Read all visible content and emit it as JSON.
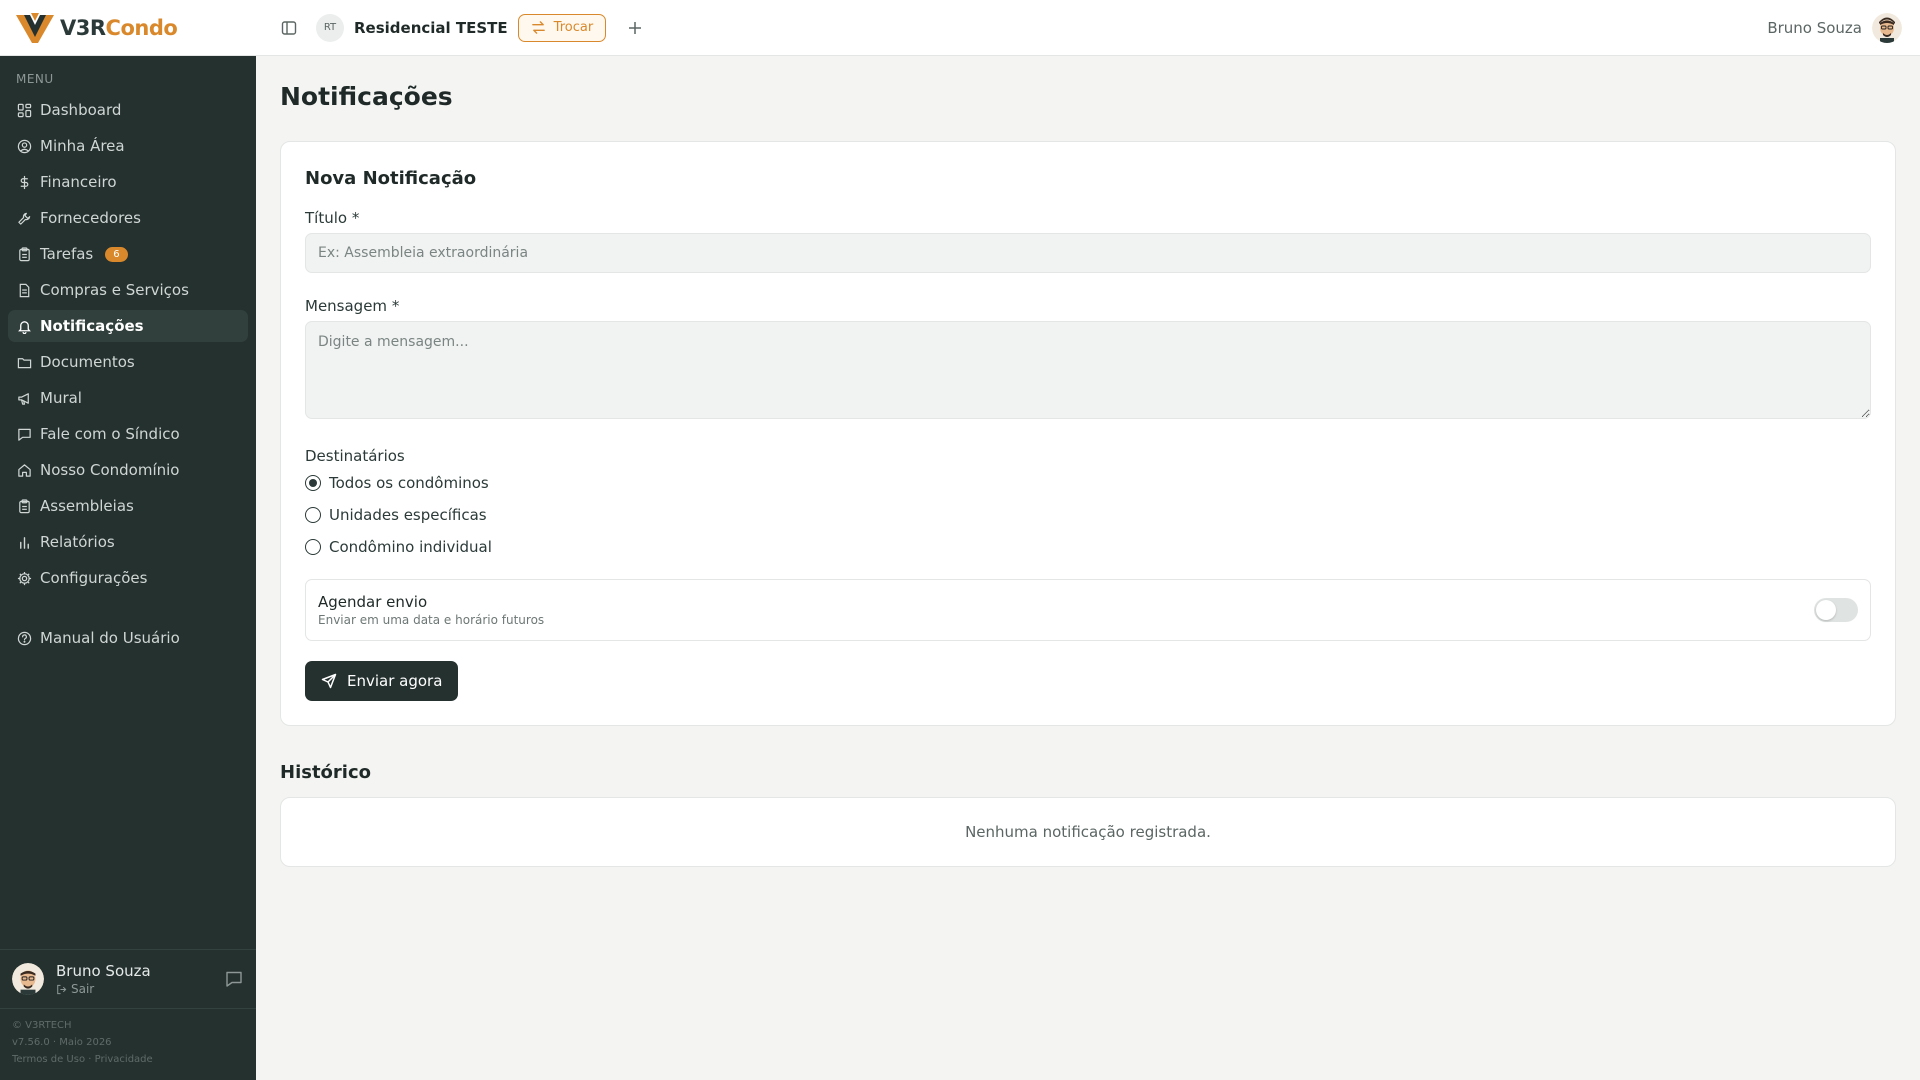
{
  "app": {
    "logo_v3r": "V3R",
    "logo_condo": "Condo",
    "brand_dark": "#25312f",
    "brand_accent": "#d9892b"
  },
  "topbar": {
    "condo_initials": "RT",
    "condo_name": "Residencial TESTE",
    "switch_label": "Trocar",
    "user_name": "Bruno Souza"
  },
  "sidebar": {
    "menu_label": "MENU",
    "items": [
      {
        "label": "Dashboard",
        "icon": "grid-icon"
      },
      {
        "label": "Minha Área",
        "icon": "user-circle-icon"
      },
      {
        "label": "Financeiro",
        "icon": "dollar-icon"
      },
      {
        "label": "Fornecedores",
        "icon": "wrench-icon"
      },
      {
        "label": "Tarefas",
        "icon": "clipboard-icon",
        "badge": "6"
      },
      {
        "label": "Compras e Serviços",
        "icon": "file-icon"
      },
      {
        "label": "Notificações",
        "icon": "bell-icon",
        "active": true
      },
      {
        "label": "Documentos",
        "icon": "folder-icon"
      },
      {
        "label": "Mural",
        "icon": "megaphone-icon"
      },
      {
        "label": "Fale com o Síndico",
        "icon": "message-icon"
      },
      {
        "label": "Nosso Condomínio",
        "icon": "home-icon"
      },
      {
        "label": "Assembleias",
        "icon": "clipboard-icon"
      },
      {
        "label": "Relatórios",
        "icon": "bar-chart-icon"
      },
      {
        "label": "Configurações",
        "icon": "gear-icon"
      }
    ],
    "help_label": "Manual do Usuário",
    "user_name": "Bruno Souza",
    "logout_label": "Sair",
    "copyright": "© V3RTECH",
    "version": "v7.56.0 · Maio 2026",
    "terms_label": "Termos de Uso",
    "legal_separator": "·",
    "privacy_label": "Privacidade"
  },
  "page": {
    "title": "Notificações"
  },
  "form": {
    "card_title": "Nova Notificação",
    "title_label": "Título *",
    "title_placeholder": "Ex: Assembleia extraordinária",
    "message_label": "Mensagem *",
    "message_placeholder": "Digite a mensagem...",
    "recipients_label": "Destinatários",
    "recipients": [
      {
        "label": "Todos os condôminos",
        "checked": true
      },
      {
        "label": "Unidades específicas",
        "checked": false
      },
      {
        "label": "Condômino individual",
        "checked": false
      }
    ],
    "schedule_title": "Agendar envio",
    "schedule_subtitle": "Enviar em uma data e horário futuros",
    "schedule_enabled": false,
    "send_label": "Enviar agora"
  },
  "history": {
    "title": "Histórico",
    "empty_text": "Nenhuma notificação registrada."
  }
}
